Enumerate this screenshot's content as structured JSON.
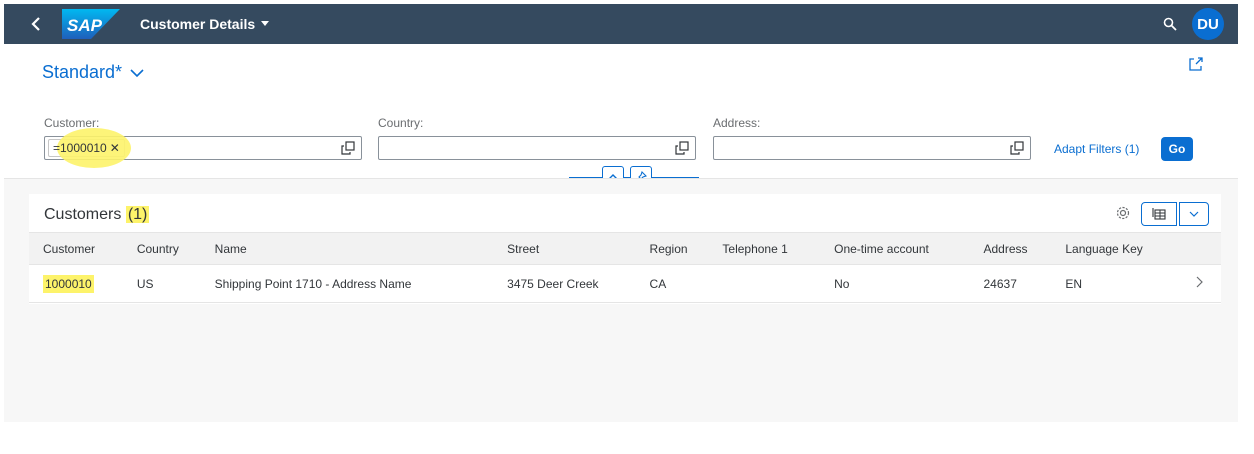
{
  "shell": {
    "logo_text": "SAP",
    "app_title": "Customer Details",
    "avatar_initials": "DU"
  },
  "header": {
    "variant_name": "Standard*",
    "filters": [
      {
        "label": "Customer:",
        "token": "=1000010"
      },
      {
        "label": "Country:",
        "token": ""
      },
      {
        "label": "Address:",
        "token": ""
      }
    ],
    "adapt_filters_label": "Adapt Filters (1)",
    "go_label": "Go"
  },
  "table": {
    "title": "Customers",
    "count": "(1)",
    "columns": [
      "Customer",
      "Country",
      "Name",
      "Street",
      "Region",
      "Telephone 1",
      "One-time account",
      "Address",
      "Language Key"
    ],
    "rows": [
      {
        "customer": "1000010",
        "country": "US",
        "name": "Shipping Point 1710 - Address Name",
        "street": "3475 Deer Creek",
        "region": "CA",
        "telephone": "",
        "one_time_account": "No",
        "address": "24637",
        "language_key": "EN"
      }
    ]
  },
  "colors": {
    "shell_bg": "#354a5f",
    "brand_blue": "#0a6ed1",
    "highlight": "#fdf36a"
  }
}
